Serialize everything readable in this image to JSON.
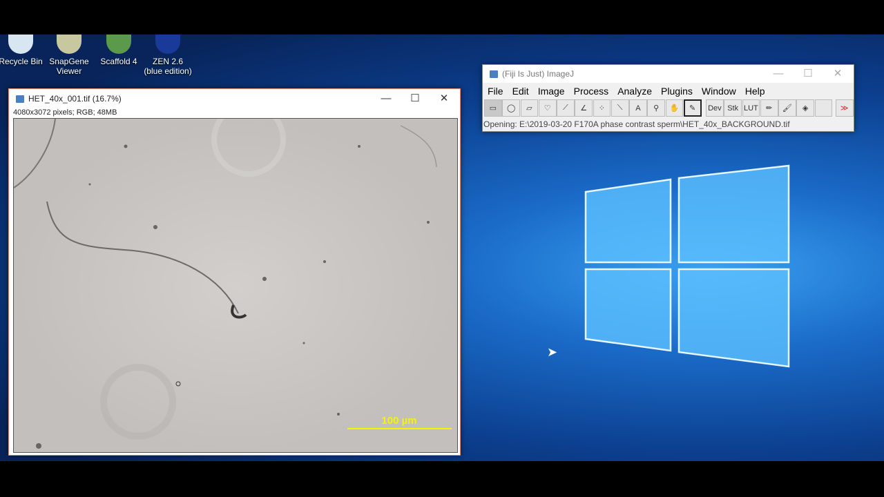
{
  "desktop": {
    "icons": [
      {
        "label": "Recycle Bin"
      },
      {
        "label": "SnapGene Viewer"
      },
      {
        "label": "Scaffold 4"
      },
      {
        "label": "ZEN 2.6 (blue edition)"
      }
    ]
  },
  "image_window": {
    "title": "HET_40x_001.tif (16.7%)",
    "info": "4080x3072 pixels; RGB; 48MB",
    "scale_bar_label": "100 µm",
    "scale_bar_color": "#f5f500"
  },
  "fiji": {
    "title": "(Fiji Is Just) ImageJ",
    "menu": [
      "File",
      "Edit",
      "Image",
      "Process",
      "Analyze",
      "Plugins",
      "Window",
      "Help"
    ],
    "tools": [
      {
        "name": "rectangle",
        "glyph": "▭"
      },
      {
        "name": "oval",
        "glyph": "◯"
      },
      {
        "name": "polygon",
        "glyph": "▱"
      },
      {
        "name": "freehand",
        "glyph": "♡"
      },
      {
        "name": "line",
        "glyph": "⟋"
      },
      {
        "name": "angle",
        "glyph": "∠"
      },
      {
        "name": "point",
        "glyph": "⁘"
      },
      {
        "name": "wand",
        "glyph": "⟍"
      },
      {
        "name": "text",
        "glyph": "A"
      },
      {
        "name": "magnifier",
        "glyph": "⚲"
      },
      {
        "name": "hand",
        "glyph": "✋"
      },
      {
        "name": "color-picker",
        "glyph": "✎"
      },
      {
        "name": "dev",
        "glyph": "Dev"
      },
      {
        "name": "stk",
        "glyph": "Stk"
      },
      {
        "name": "lut",
        "glyph": "LUT"
      },
      {
        "name": "pencil",
        "glyph": "✏"
      },
      {
        "name": "brush",
        "glyph": "🖌"
      },
      {
        "name": "flood-fill",
        "glyph": "◈"
      },
      {
        "name": "blank",
        "glyph": ""
      },
      {
        "name": "more",
        "glyph": "≫"
      }
    ],
    "status": "Opening: E:\\2019-03-20 F170A phase contrast sperm\\HET_40x_BACKGROUND.tif"
  }
}
